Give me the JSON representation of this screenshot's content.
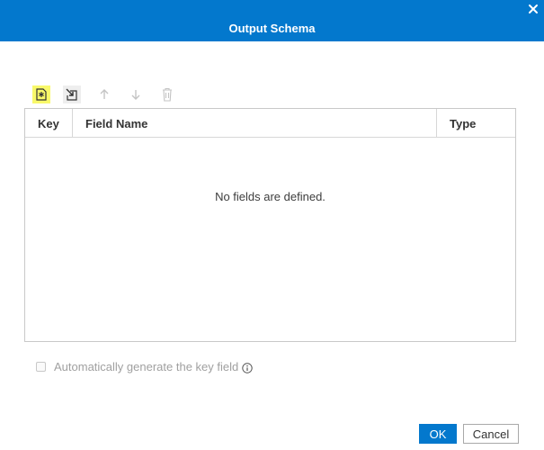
{
  "dialog": {
    "title": "Output Schema",
    "close_icon": "close-icon"
  },
  "toolbar": {
    "items": [
      {
        "name": "new-field",
        "icon": "new-field-icon",
        "state": "highlighted"
      },
      {
        "name": "import-fields",
        "icon": "import-icon",
        "state": "enabled"
      },
      {
        "name": "move-up",
        "icon": "arrow-up-icon",
        "state": "disabled"
      },
      {
        "name": "move-down",
        "icon": "arrow-down-icon",
        "state": "disabled"
      },
      {
        "name": "delete",
        "icon": "trash-icon",
        "state": "disabled"
      }
    ]
  },
  "table": {
    "columns": [
      "Key",
      "Field Name",
      "Type"
    ],
    "empty_message": "No fields are defined."
  },
  "options": {
    "auto_key_label": "Automatically generate the key field",
    "auto_key_checked": false,
    "auto_key_enabled": false
  },
  "footer": {
    "ok_label": "OK",
    "cancel_label": "Cancel"
  },
  "colors": {
    "accent": "#0378cd",
    "highlight": "#f8f86a"
  }
}
